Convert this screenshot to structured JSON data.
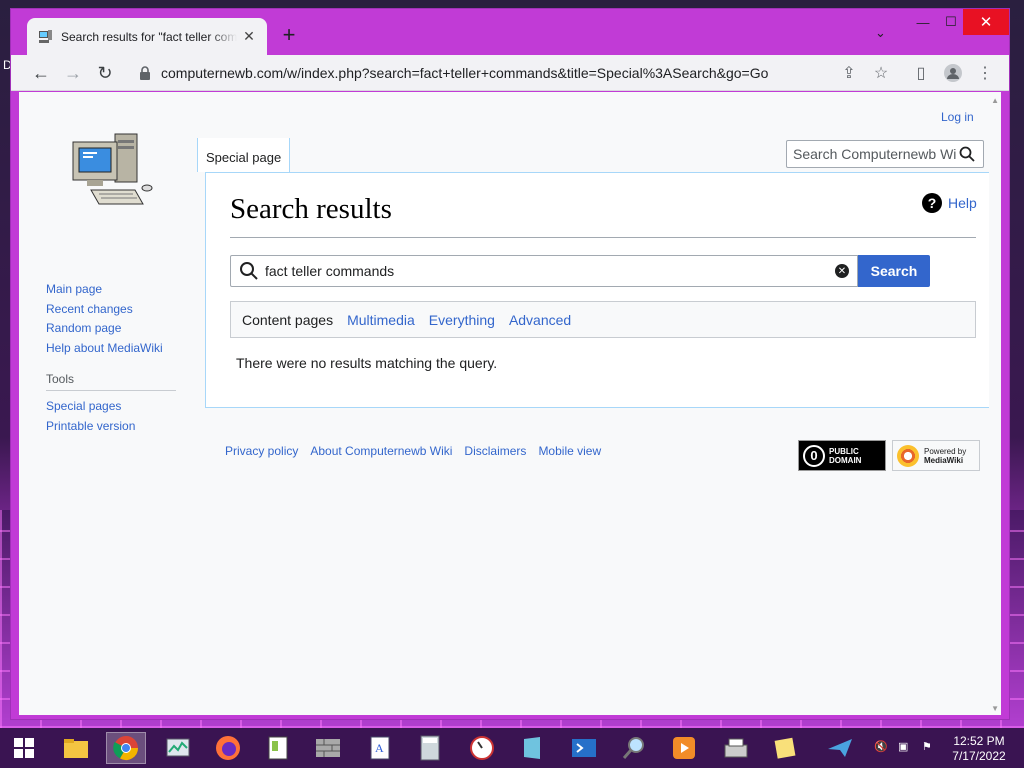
{
  "browser": {
    "tab_title": "Search results for \"fact teller commands\" - Computernewb Wiki",
    "url": "computernewb.com/w/index.php?search=fact+teller+commands&title=Special%3ASearch&go=Go"
  },
  "desktop": {
    "edge_letter": "D"
  },
  "page": {
    "login": "Log in",
    "tab_label": "Special page",
    "header_search_placeholder": "Search Computernewb Wiki",
    "title": "Search results",
    "help": "Help",
    "search_value": "fact teller commands",
    "search_button": "Search",
    "profiles": {
      "content": "Content pages",
      "multimedia": "Multimedia",
      "everything": "Everything",
      "advanced": "Advanced"
    },
    "no_results": "There were no results matching the query."
  },
  "sidebar": {
    "nav": [
      "Main page",
      "Recent changes",
      "Random page",
      "Help about MediaWiki"
    ],
    "tools_heading": "Tools",
    "tools": [
      "Special pages",
      "Printable version"
    ]
  },
  "footer": {
    "links": [
      "Privacy policy",
      "About Computernewb Wiki",
      "Disclaimers",
      "Mobile view"
    ],
    "pd_line1": "PUBLIC",
    "pd_line2": "DOMAIN",
    "mw_line1": "Powered by",
    "mw_line2": "MediaWiki"
  },
  "taskbar": {
    "time": "12:52 PM",
    "date": "7/17/2022"
  },
  "colors": {
    "link": "#3366cc",
    "window_frame": "#c13bd6",
    "search_button": "#3366cc"
  }
}
